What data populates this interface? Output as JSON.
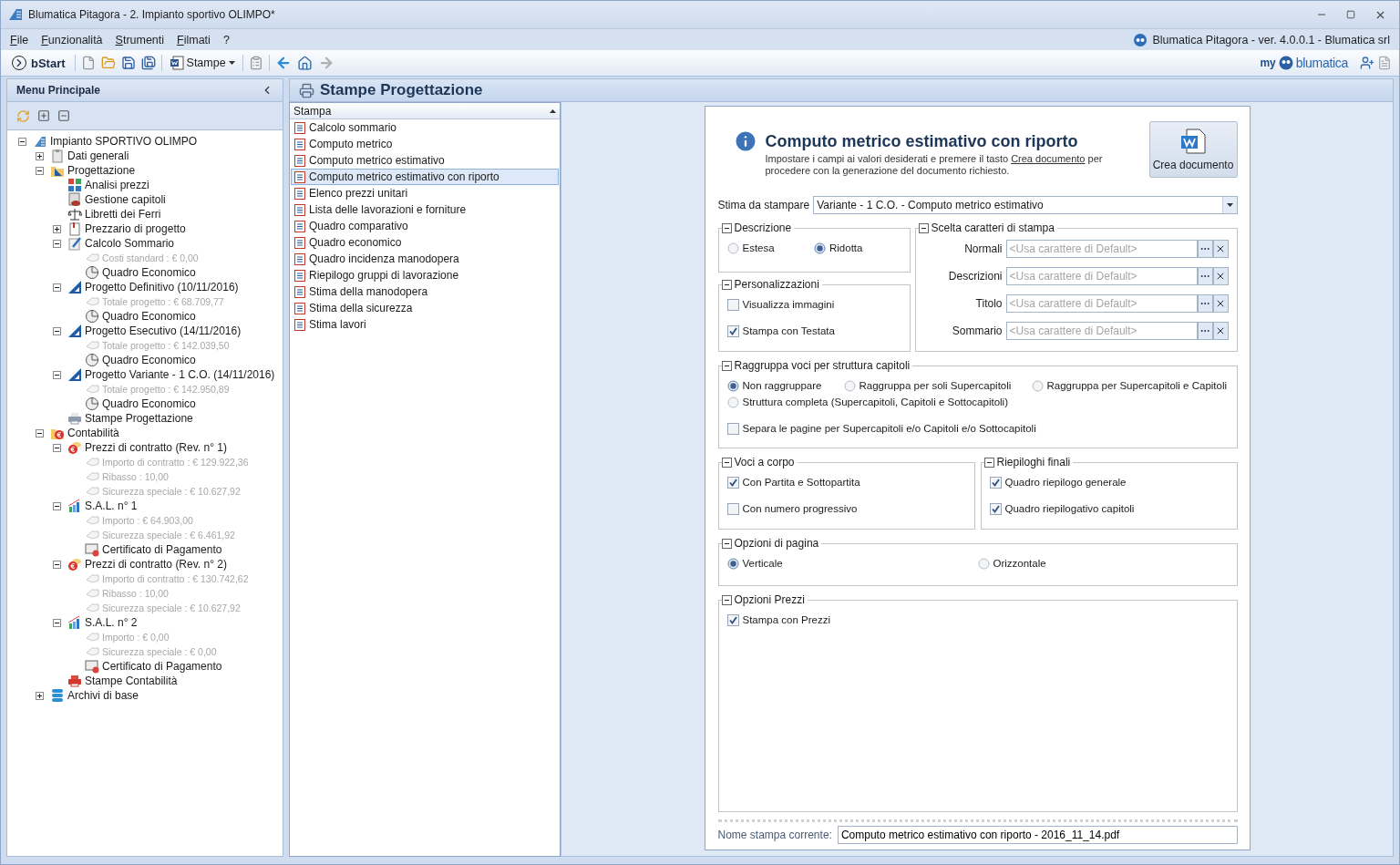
{
  "window": {
    "title": "Blumatica Pitagora - 2. Impianto sportivo OLIMPO*"
  },
  "menu": [
    "File",
    "Funzionalità",
    "Strumenti",
    "Filmati",
    "?"
  ],
  "product_info": "Blumatica Pitagora - ver. 4.0.0.1 - Blumatica srl",
  "toolbar": {
    "start_label": "bStart",
    "print_label": "Stampe",
    "forward_disabled": true,
    "logo": {
      "prefix": "my",
      "name": "blumatica"
    }
  },
  "sidebar": {
    "title": "Menu Principale",
    "tree": [
      {
        "label": "Impianto SPORTIVO OLIMPO",
        "kind": "project",
        "expanded": true,
        "children": [
          {
            "label": "Dati generali",
            "kind": "clipboard",
            "expanded": false
          },
          {
            "label": "Progettazione",
            "kind": "design-folder",
            "expanded": true,
            "children": [
              {
                "label": "Analisi prezzi",
                "kind": "grid"
              },
              {
                "label": "Gestione capitoli",
                "kind": "book"
              },
              {
                "label": "Libretti dei Ferri",
                "kind": "scale"
              },
              {
                "label": "Prezzario di progetto",
                "kind": "page",
                "expanded": false
              },
              {
                "label": "Calcolo Sommario",
                "kind": "pencil",
                "expanded": true,
                "children": [
                  {
                    "label": "Costi standard : € 0,00",
                    "kind": "info"
                  },
                  {
                    "label": "Quadro Economico",
                    "kind": "pie"
                  }
                ]
              },
              {
                "label": "Progetto Definitivo (10/11/2016)",
                "kind": "ruler",
                "expanded": true,
                "children": [
                  {
                    "label": "Totale progetto : € 68.709,77",
                    "kind": "info"
                  },
                  {
                    "label": "Quadro Economico",
                    "kind": "pie"
                  }
                ]
              },
              {
                "label": "Progetto Esecutivo (14/11/2016)",
                "kind": "ruler",
                "expanded": true,
                "children": [
                  {
                    "label": "Totale progetto : € 142.039,50",
                    "kind": "info"
                  },
                  {
                    "label": "Quadro Economico",
                    "kind": "pie"
                  }
                ]
              },
              {
                "label": "Progetto Variante - 1 C.O. (14/11/2016)",
                "kind": "ruler",
                "expanded": true,
                "children": [
                  {
                    "label": "Totale progetto : € 142.950,89",
                    "kind": "info"
                  },
                  {
                    "label": "Quadro Economico",
                    "kind": "pie"
                  }
                ]
              },
              {
                "label": "Stampe Progettazione",
                "kind": "printer"
              }
            ]
          },
          {
            "label": "Contabilità",
            "kind": "euro-folder",
            "expanded": true,
            "children": [
              {
                "label": "Prezzi di contratto (Rev. n° 1)",
                "kind": "coin",
                "expanded": true,
                "children": [
                  {
                    "label": "Importo di contratto  : € 129.922,36",
                    "kind": "info"
                  },
                  {
                    "label": "Ribasso  : 10,00",
                    "kind": "info"
                  },
                  {
                    "label": "Sicurezza speciale  : € 10.627,92",
                    "kind": "info"
                  }
                ]
              },
              {
                "label": "S.A.L. n° 1",
                "kind": "chart",
                "expanded": true,
                "children": [
                  {
                    "label": "Importo : € 64.903,00",
                    "kind": "info"
                  },
                  {
                    "label": "Sicurezza speciale  : € 6.461,92",
                    "kind": "info"
                  },
                  {
                    "label": "Certificato di Pagamento",
                    "kind": "certificate"
                  }
                ]
              },
              {
                "label": "Prezzi di contratto (Rev. n° 2)",
                "kind": "coin",
                "expanded": true,
                "children": [
                  {
                    "label": "Importo di contratto  : € 130.742,62",
                    "kind": "info"
                  },
                  {
                    "label": "Ribasso  : 10,00",
                    "kind": "info"
                  },
                  {
                    "label": "Sicurezza speciale  : € 10.627,92",
                    "kind": "info"
                  }
                ]
              },
              {
                "label": "S.A.L. n° 2",
                "kind": "chart",
                "expanded": true,
                "children": [
                  {
                    "label": "Importo : € 0,00",
                    "kind": "info"
                  },
                  {
                    "label": "Sicurezza speciale  : € 0,00",
                    "kind": "info"
                  },
                  {
                    "label": "Certificato di Pagamento",
                    "kind": "certificate"
                  }
                ]
              },
              {
                "label": "Stampe Contabilità",
                "kind": "printer-red"
              }
            ]
          },
          {
            "label": "Archivi di base",
            "kind": "database",
            "expanded": false
          }
        ]
      }
    ]
  },
  "section_title": "Stampe Progettazione",
  "print_list": {
    "column": "Stampa",
    "items": [
      {
        "label": "Calcolo sommario",
        "selected": false
      },
      {
        "label": "Computo metrico",
        "selected": false
      },
      {
        "label": "Computo metrico estimativo",
        "selected": false
      },
      {
        "label": "Computo metrico estimativo con riporto",
        "selected": true
      },
      {
        "label": "Elenco prezzi unitari",
        "selected": false
      },
      {
        "label": "Lista delle lavorazioni e forniture",
        "selected": false
      },
      {
        "label": "Quadro comparativo",
        "selected": false
      },
      {
        "label": "Quadro economico",
        "selected": false
      },
      {
        "label": "Quadro incidenza manodopera",
        "selected": false
      },
      {
        "label": "Riepilogo gruppi di lavorazione",
        "selected": false
      },
      {
        "label": "Stima della manodopera",
        "selected": false
      },
      {
        "label": "Stima della sicurezza",
        "selected": false
      },
      {
        "label": "Stima lavori",
        "selected": false
      }
    ]
  },
  "form": {
    "title": "Computo metrico estimativo con riporto",
    "hint": {
      "before": "Impostare i campi ai valori desiderati e premere il tasto ",
      "link": "Crea documento",
      "after": " per procedere con la generazione del documento richiesto."
    },
    "create_button": "Crea documento",
    "estimate": {
      "label": "Stima da stampare",
      "value": "Variante - 1 C.O. - Computo metrico estimativo"
    },
    "description": {
      "title": "Descrizione",
      "options": [
        {
          "label": "Estesa",
          "selected": false
        },
        {
          "label": "Ridotta",
          "selected": true
        }
      ]
    },
    "customizations": {
      "title": "Personalizzazioni",
      "options": [
        {
          "label": "Visualizza immagini",
          "checked": false
        },
        {
          "label": "Stampa con Testata",
          "checked": true
        }
      ]
    },
    "fonts": {
      "title": "Scelta caratteri di stampa",
      "rows": [
        {
          "label": "Normali",
          "placeholder": "<Usa carattere di Default>"
        },
        {
          "label": "Descrizioni",
          "placeholder": "<Usa carattere di Default>"
        },
        {
          "label": "Titolo",
          "placeholder": "<Usa carattere di Default>"
        },
        {
          "label": "Sommario",
          "placeholder": "<Usa carattere di Default>"
        }
      ]
    },
    "grouping": {
      "title": "Raggruppa voci per struttura capitoli",
      "options": [
        {
          "label": "Non raggruppare",
          "selected": true
        },
        {
          "label": "Raggruppa per soli Supercapitoli",
          "selected": false
        },
        {
          "label": "Raggruppa per Supercapitoli e Capitoli",
          "selected": false
        },
        {
          "label": "Struttura completa (Supercapitoli, Capitoli e Sottocapitoli)",
          "selected": false
        }
      ],
      "separate": {
        "label": "Separa le pagine per Supercapitoli e/o Capitoli e/o Sottocapitoli",
        "checked": false
      }
    },
    "lump_items": {
      "title": "Voci a corpo",
      "options": [
        {
          "label": "Con Partita e Sottopartita",
          "checked": true
        },
        {
          "label": "Con numero progressivo",
          "checked": false
        }
      ]
    },
    "summaries": {
      "title": "Riepiloghi finali",
      "options": [
        {
          "label": "Quadro riepilogo generale",
          "checked": true
        },
        {
          "label": "Quadro riepilogativo capitoli",
          "checked": true
        }
      ]
    },
    "page": {
      "title": "Opzioni di pagina",
      "options": [
        {
          "label": "Verticale",
          "selected": true
        },
        {
          "label": "Orizzontale",
          "selected": false
        }
      ]
    },
    "prices": {
      "title": "Opzioni Prezzi",
      "options": [
        {
          "label": "Stampa con Prezzi",
          "checked": true
        }
      ]
    },
    "filename": {
      "label": "Nome stampa corrente:",
      "value": "Computo metrico estimativo con riporto - 2016_11_14.pdf"
    }
  }
}
